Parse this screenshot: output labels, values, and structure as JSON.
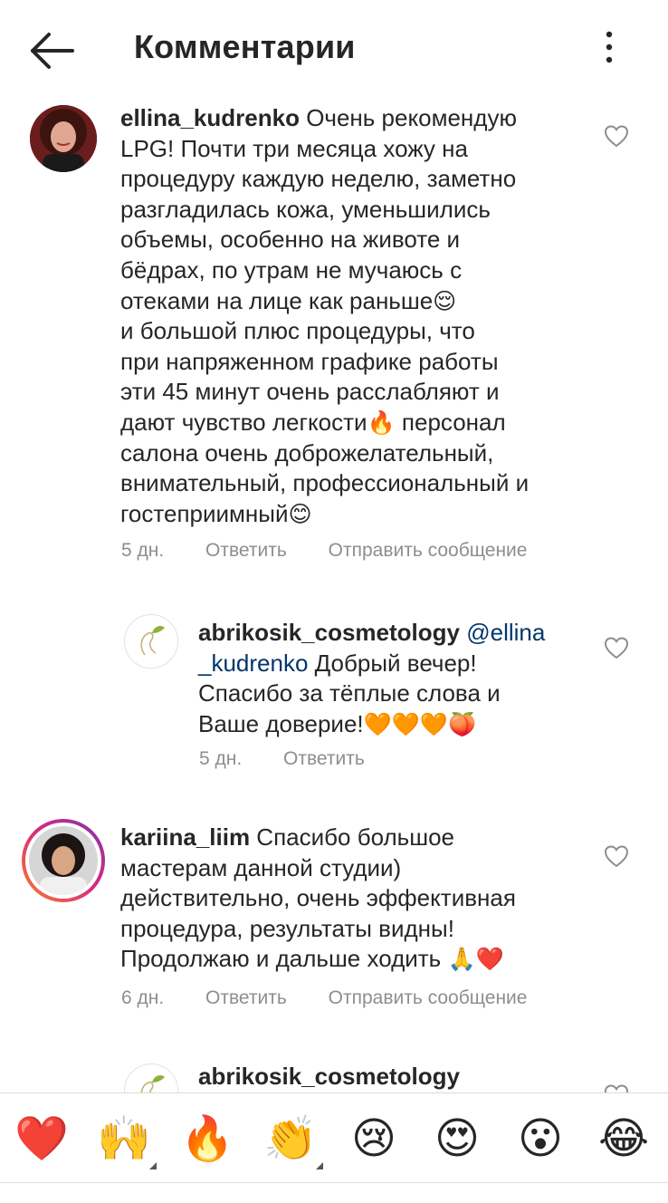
{
  "header": {
    "title": "Комментарии",
    "back_icon": "arrow-left-icon",
    "more_icon": "more-vertical-icon"
  },
  "comments": [
    {
      "username": "ellina_kudrenko",
      "lines": [
        " Очень рекомендую",
        "LPG! Почти три месяца хожу на",
        "процедуру каждую неделю, заметно",
        "разгладилась кожа, уменьшились",
        "объемы, особенно на животе и",
        "бёдрах, по утрам не мучаюсь с",
        "отеками на лице как раньше",
        "и большой плюс процедуры, что",
        "при напряженном графике работы",
        "эти 45 минут очень расслабляют и",
        "дают чувство легкости",
        " персонал",
        "салона очень доброжелательный,",
        "внимательный, профессиональный и",
        "гостеприимный"
      ],
      "emoji": [
        "😌",
        "🔥",
        "😊"
      ],
      "time": "5 дн.",
      "reply_label": "Ответить",
      "message_label": "Отправить сообщение"
    },
    {
      "username": "abrikosik_cosmetology",
      "mention_a": "@ellina",
      "mention_b": "_kudrenko",
      "lines": [
        " Добрый вечер!",
        "Спасибо за тёплые слова и",
        "Ваше доверие!"
      ],
      "emoji": [
        "🧡🧡🧡🍑"
      ],
      "time": "5 дн.",
      "reply_label": "Ответить"
    },
    {
      "username": "kariina_liim",
      "lines": [
        " Спасибо большое",
        "мастерам данной студии)",
        "действительно, очень эффективная",
        "процедура, результаты видны!",
        "Продолжаю и дальше ходить "
      ],
      "emoji": [
        "🙏❤️"
      ],
      "time": "6 дн.",
      "reply_label": "Ответить",
      "message_label": "Отправить сообщение"
    },
    {
      "username": "abrikosik_cosmetology"
    }
  ],
  "reactions": [
    "❤️",
    "🙌",
    "🔥",
    "👏",
    "😢",
    "😍",
    "😮",
    "😂"
  ],
  "colors": {
    "text": "#262626",
    "secondary": "#8e8e8e",
    "mention": "#00376b",
    "story_ring_a": "#f58529",
    "story_ring_b": "#dd2a7b",
    "brand_green": "#8bb33a"
  }
}
